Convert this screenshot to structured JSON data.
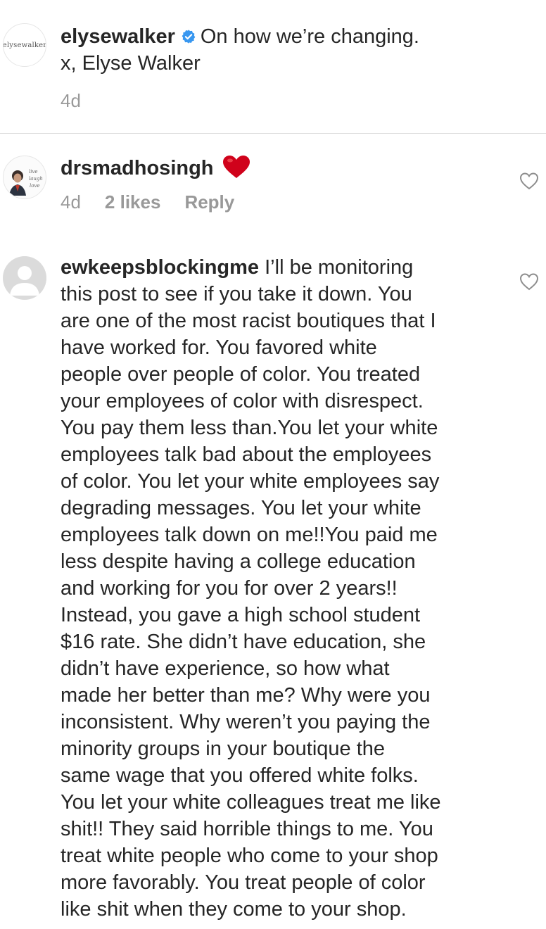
{
  "caption": {
    "avatar_text": "elysewalker",
    "username": "elysewalker",
    "verified_icon": "verified-badge-icon",
    "text_line1": "On how we’re changing.",
    "text_line2": "x, Elyse Walker",
    "time": "4d"
  },
  "comments": [
    {
      "username": "drsmadhosingh",
      "avatar_text": [
        "live",
        "laugh",
        "love"
      ],
      "emoji": "❤️",
      "time": "4d",
      "likes": "2 likes",
      "reply_label": "Reply"
    },
    {
      "username": "ewkeepsblockingme",
      "first_line": "I’ll be monitoring",
      "lines": [
        "this post to see if you take it down. You",
        "are one of the most racist boutiques that I",
        "have worked for. You favored white",
        "people over people of color. You treated",
        "your employees of color with disrespect.",
        "You pay them less than.You let your white",
        "employees talk bad about the employees",
        "of color. You let your white employees say",
        "degrading messages. You let your white",
        "employees talk down on me!!You paid me",
        "less despite having a college education",
        "and working for you for over 2 years!!",
        "Instead, you gave a high school student",
        "$16 rate. She didn’t have education, she",
        "didn’t have experience, so how what",
        "made her better than me? Why were you",
        "inconsistent. Why weren’t you paying the",
        "minority groups in your boutique the",
        "same wage that you offered white folks.",
        "You let your white colleagues treat me like",
        "shit!! They said horrible things to me. You",
        "treat white people who come to your shop",
        "more favorably. You treat people of color",
        "like shit when they come to your shop."
      ]
    }
  ],
  "colors": {
    "text": "#262626",
    "meta": "#999999",
    "divider": "#dbdbdb",
    "verified_blue": "#3897f0",
    "heart_red": "#d0021b"
  }
}
